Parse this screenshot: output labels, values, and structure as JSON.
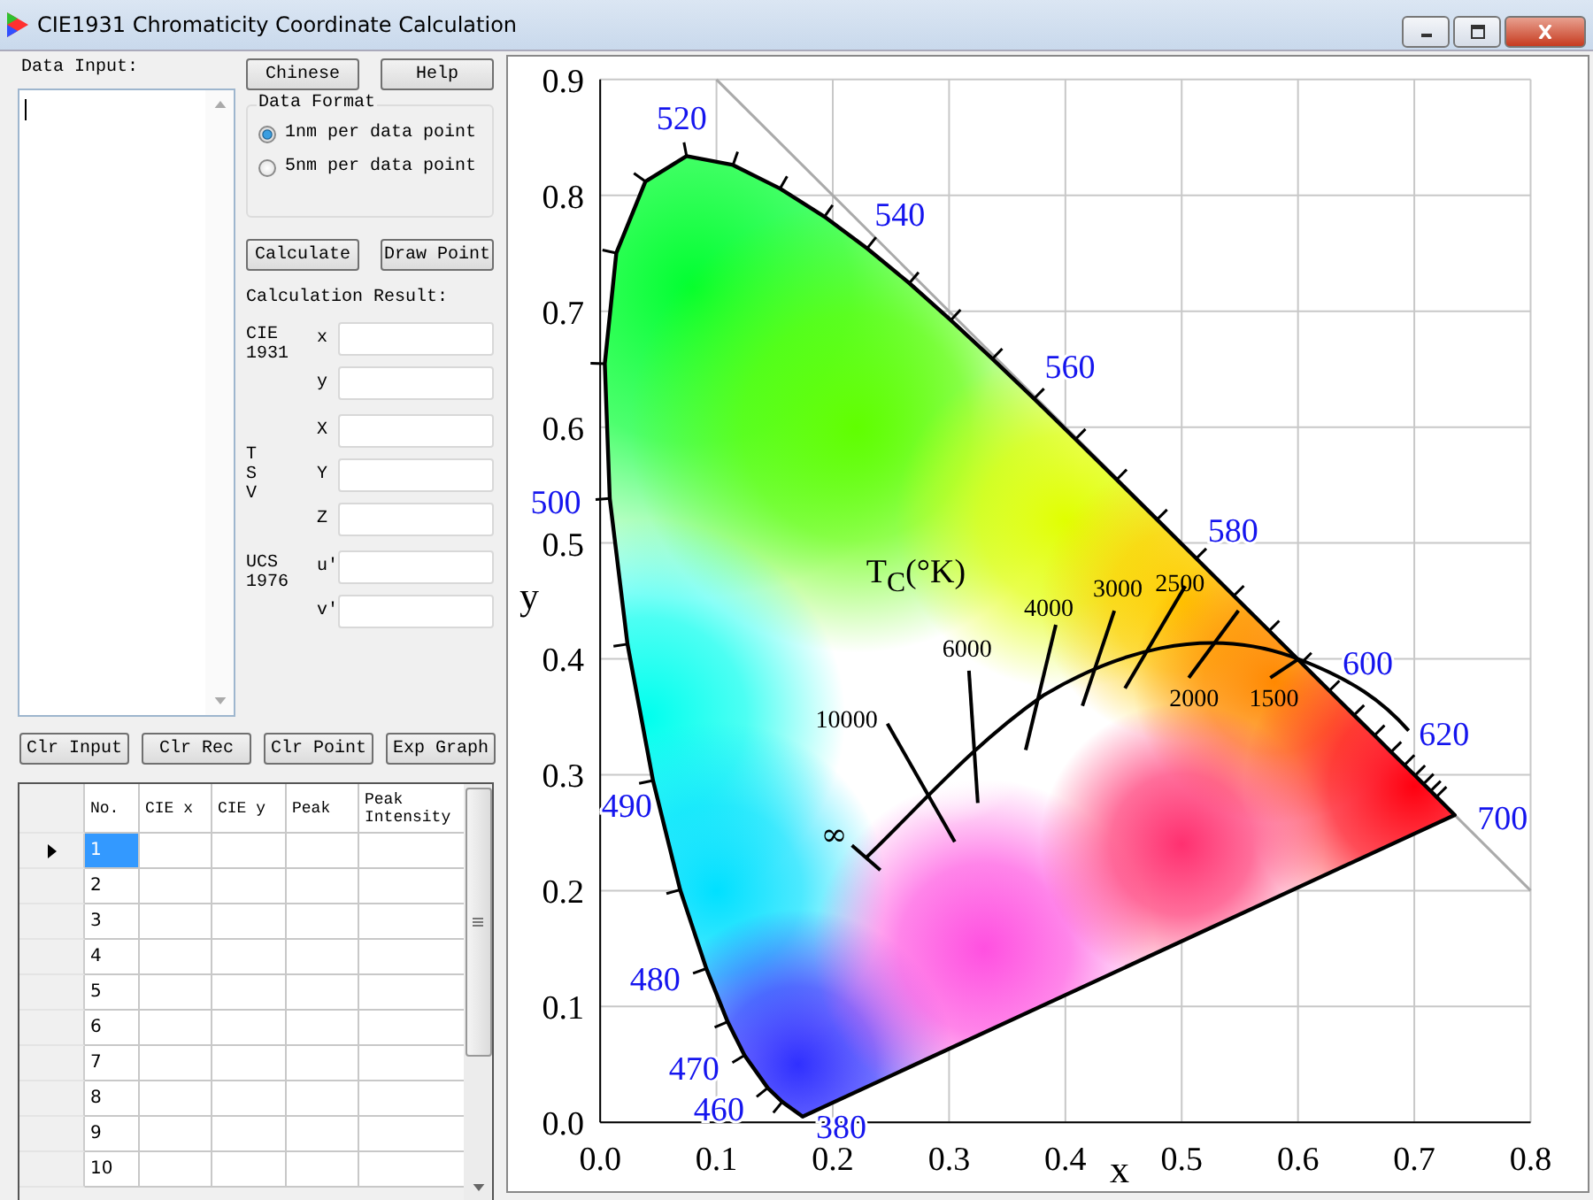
{
  "window": {
    "title": "CIE1931 Chromaticity Coordinate Calculation"
  },
  "data_input": {
    "label": "Data Input:"
  },
  "top_buttons": [
    "Chinese",
    "Help"
  ],
  "data_format": {
    "title": "Data Format",
    "options": [
      {
        "label": "1nm per data point",
        "selected": true
      },
      {
        "label": "5nm per data point",
        "selected": false
      }
    ]
  },
  "action_buttons": [
    "Calculate",
    "Draw Point"
  ],
  "result": {
    "title": "Calculation Result:",
    "groups": [
      {
        "name": "CIE 1931",
        "kind": "wrap",
        "fields": [
          "x",
          "y"
        ]
      },
      {
        "name": "TSV",
        "kind": "vertical",
        "fields": [
          "X",
          "Y",
          "Z"
        ]
      },
      {
        "name": "UCS 1976",
        "kind": "wrap",
        "fields": [
          "u'",
          "v'"
        ]
      }
    ]
  },
  "bottom_buttons": [
    "Clr Input",
    "Clr Rec",
    "Clr Point",
    "Exp Graph"
  ],
  "table": {
    "columns": [
      "No.",
      "CIE x",
      "CIE y",
      "Peak",
      "Peak Intensity"
    ],
    "rows": [
      {
        "no": "1",
        "selected": true
      },
      {
        "no": "2",
        "selected": false
      },
      {
        "no": "3",
        "selected": false
      },
      {
        "no": "4",
        "selected": false
      },
      {
        "no": "5",
        "selected": false
      },
      {
        "no": "6",
        "selected": false
      },
      {
        "no": "7",
        "selected": false
      },
      {
        "no": "8",
        "selected": false
      },
      {
        "no": "9",
        "selected": false
      },
      {
        "no": "10",
        "selected": false
      }
    ]
  },
  "diagram": {
    "xlabel": "x",
    "ylabel": "y",
    "xticks": [
      "0.0",
      "0.1",
      "0.2",
      "0.3",
      "0.4",
      "0.5",
      "0.6",
      "0.7",
      "0.8"
    ],
    "yticks": [
      "0.9",
      "0.8",
      "0.7",
      "0.6",
      "0.5",
      "0.4",
      "0.3",
      "0.2",
      "0.1",
      "0.0"
    ],
    "wavelengths": [
      "520",
      "540",
      "560",
      "580",
      "600",
      "620",
      "700",
      "500",
      "490",
      "480",
      "470",
      "460",
      "380"
    ],
    "temperature_title": "T$_{C}$(°K)",
    "temperatures": [
      "10000",
      "6000",
      "4000",
      "3000",
      "2500",
      "2000",
      "1500",
      "∞"
    ]
  }
}
